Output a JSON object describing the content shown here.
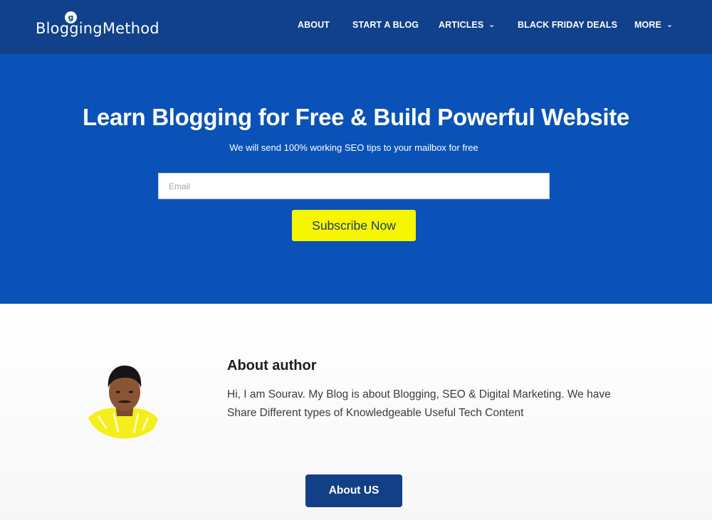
{
  "header": {
    "logo_text": "BloggingMethod",
    "nav": [
      {
        "label": "ABOUT"
      },
      {
        "label": "START A BLOG"
      },
      {
        "label": "ARTICLES",
        "dropdown": true
      },
      {
        "label": "BLACK FRIDAY DEALS"
      },
      {
        "label": "MORE",
        "dropdown": true
      }
    ],
    "chevron_icon": "chevron-down-icon"
  },
  "hero": {
    "title": "Learn Blogging for Free & Build Powerful Website",
    "subtitle": "We will send 100% working SEO tips to your mailbox for free",
    "email_placeholder": "Email",
    "email_value": "",
    "subscribe_label": "Subscribe Now"
  },
  "about": {
    "title": "About author",
    "text": "Hi, I am Sourav. My Blog is about Blogging, SEO & Digital Marketing. We have Share Different types of Knowledgeable Useful Tech Content",
    "button_label": "About US"
  },
  "colors": {
    "header_bg": "#10418a",
    "hero_bg": "#0a52b7",
    "subscribe_bg": "#f6f600",
    "about_button_bg": "#123f86"
  }
}
